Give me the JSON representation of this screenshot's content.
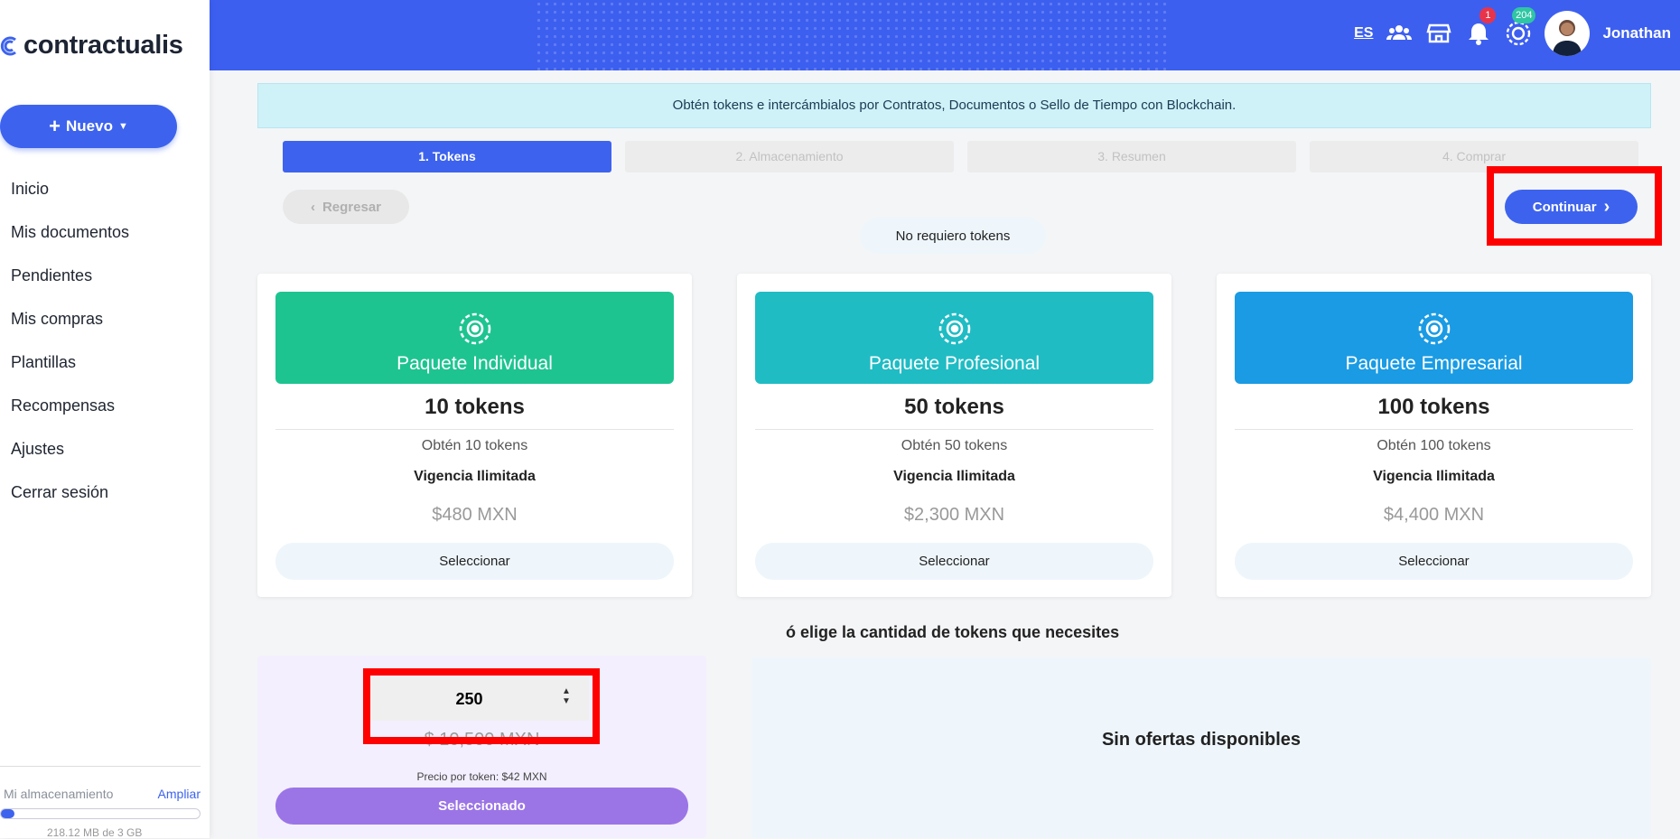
{
  "app": {
    "brand": "contractualis"
  },
  "sidebar": {
    "new_button": "Nuevo",
    "items": [
      {
        "label": "Inicio"
      },
      {
        "label": "Mis documentos"
      },
      {
        "label": "Pendientes"
      },
      {
        "label": "Mis compras"
      },
      {
        "label": "Plantillas"
      },
      {
        "label": "Recompensas"
      },
      {
        "label": "Ajustes"
      },
      {
        "label": "Cerrar sesión"
      }
    ],
    "storage": {
      "label": "Mi almacenamiento",
      "link": "Ampliar",
      "used": "218.12 MB de 3 GB",
      "fraction_used": 0.07
    }
  },
  "topbar": {
    "language": "ES",
    "notifications_count": "1",
    "tokens_count": "204",
    "user_name": "Jonathan",
    "icons": [
      "users-icon",
      "store-icon",
      "bell-icon",
      "token-icon"
    ]
  },
  "alert": {
    "text": "Obtén tokens e intercámbialos por Contratos, Documentos o Sello de Tiempo con Blockchain."
  },
  "steps": [
    {
      "label": "1. Tokens",
      "active": true
    },
    {
      "label": "2. Almacenamiento",
      "active": false
    },
    {
      "label": "3. Resumen",
      "active": false
    },
    {
      "label": "4. Comprar",
      "active": false
    }
  ],
  "actions": {
    "back": "Regresar",
    "continue": "Continuar",
    "no_tokens": "No requiero tokens"
  },
  "packages": [
    {
      "title": "Paquete Individual",
      "tokens": "10 tokens",
      "desc": "Obtén 10 tokens",
      "validity": "Vigencia Ilimitada",
      "price": "$480 MXN",
      "button": "Seleccionar",
      "color": "#1ec490"
    },
    {
      "title": "Paquete Profesional",
      "tokens": "50 tokens",
      "desc": "Obtén 50 tokens",
      "validity": "Vigencia Ilimitada",
      "price": "$2,300 MXN",
      "button": "Seleccionar",
      "color": "#1fbcc4"
    },
    {
      "title": "Paquete Empresarial",
      "tokens": "100 tokens",
      "desc": "Obtén 100 tokens",
      "validity": "Vigencia Ilimitada",
      "price": "$4,400 MXN",
      "button": "Seleccionar",
      "color": "#1a9be4"
    }
  ],
  "custom": {
    "subtitle": "ó elige la cantidad de tokens que necesites",
    "quantity": "250",
    "price": "$ 10,500 MXN",
    "price_per_token": "Precio por token: $42 MXN",
    "button": "Seleccionado"
  },
  "offers": {
    "empty_text": "Sin ofertas disponibles"
  },
  "colors": {
    "primary": "#3d63ee",
    "topbar": "#3d5ff0",
    "selected": "#9b75e6",
    "highlight": "#ff0000"
  }
}
